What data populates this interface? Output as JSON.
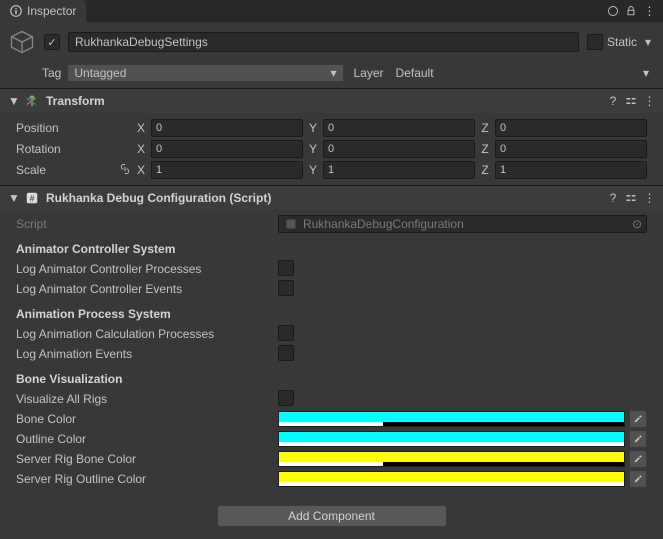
{
  "tab": {
    "title": "Inspector"
  },
  "header": {
    "enabled": true,
    "name": "RukhankaDebugSettings",
    "static_label": "Static",
    "static_checked": false,
    "tag_label": "Tag",
    "tag_value": "Untagged",
    "layer_label": "Layer",
    "layer_value": "Default"
  },
  "transform": {
    "title": "Transform",
    "position": {
      "label": "Position",
      "x": "0",
      "y": "0",
      "z": "0"
    },
    "rotation": {
      "label": "Rotation",
      "x": "0",
      "y": "0",
      "z": "0"
    },
    "scale": {
      "label": "Scale",
      "x": "1",
      "y": "1",
      "z": "1"
    }
  },
  "debugConfig": {
    "title": "Rukhanka Debug Configuration (Script)",
    "script_label": "Script",
    "script_value": "RukhankaDebugConfiguration",
    "sections": {
      "animatorController": {
        "title": "Animator Controller System",
        "logProcesses": {
          "label": "Log Animator Controller Processes",
          "checked": false
        },
        "logEvents": {
          "label": "Log Animator Controller Events",
          "checked": false
        }
      },
      "animationProcess": {
        "title": "Animation Process System",
        "logCalc": {
          "label": "Log Animation Calculation Processes",
          "checked": false
        },
        "logEvents": {
          "label": "Log Animation Events",
          "checked": false
        }
      },
      "boneViz": {
        "title": "Bone Visualization",
        "visualizeAll": {
          "label": "Visualize All Rigs",
          "checked": false
        },
        "boneColor": {
          "label": "Bone Color",
          "hex": "#00FFFF",
          "alpha": 30
        },
        "outlineColor": {
          "label": "Outline Color",
          "hex": "#00FFFF",
          "alpha": 100
        },
        "serverBoneColor": {
          "label": "Server Rig Bone Color",
          "hex": "#FFFF00",
          "alpha": 30
        },
        "serverOutlineColor": {
          "label": "Server Rig Outline Color",
          "hex": "#FFFF00",
          "alpha": 100
        }
      }
    }
  },
  "addComponent": {
    "label": "Add Component"
  },
  "axes": {
    "x": "X",
    "y": "Y",
    "z": "Z"
  }
}
